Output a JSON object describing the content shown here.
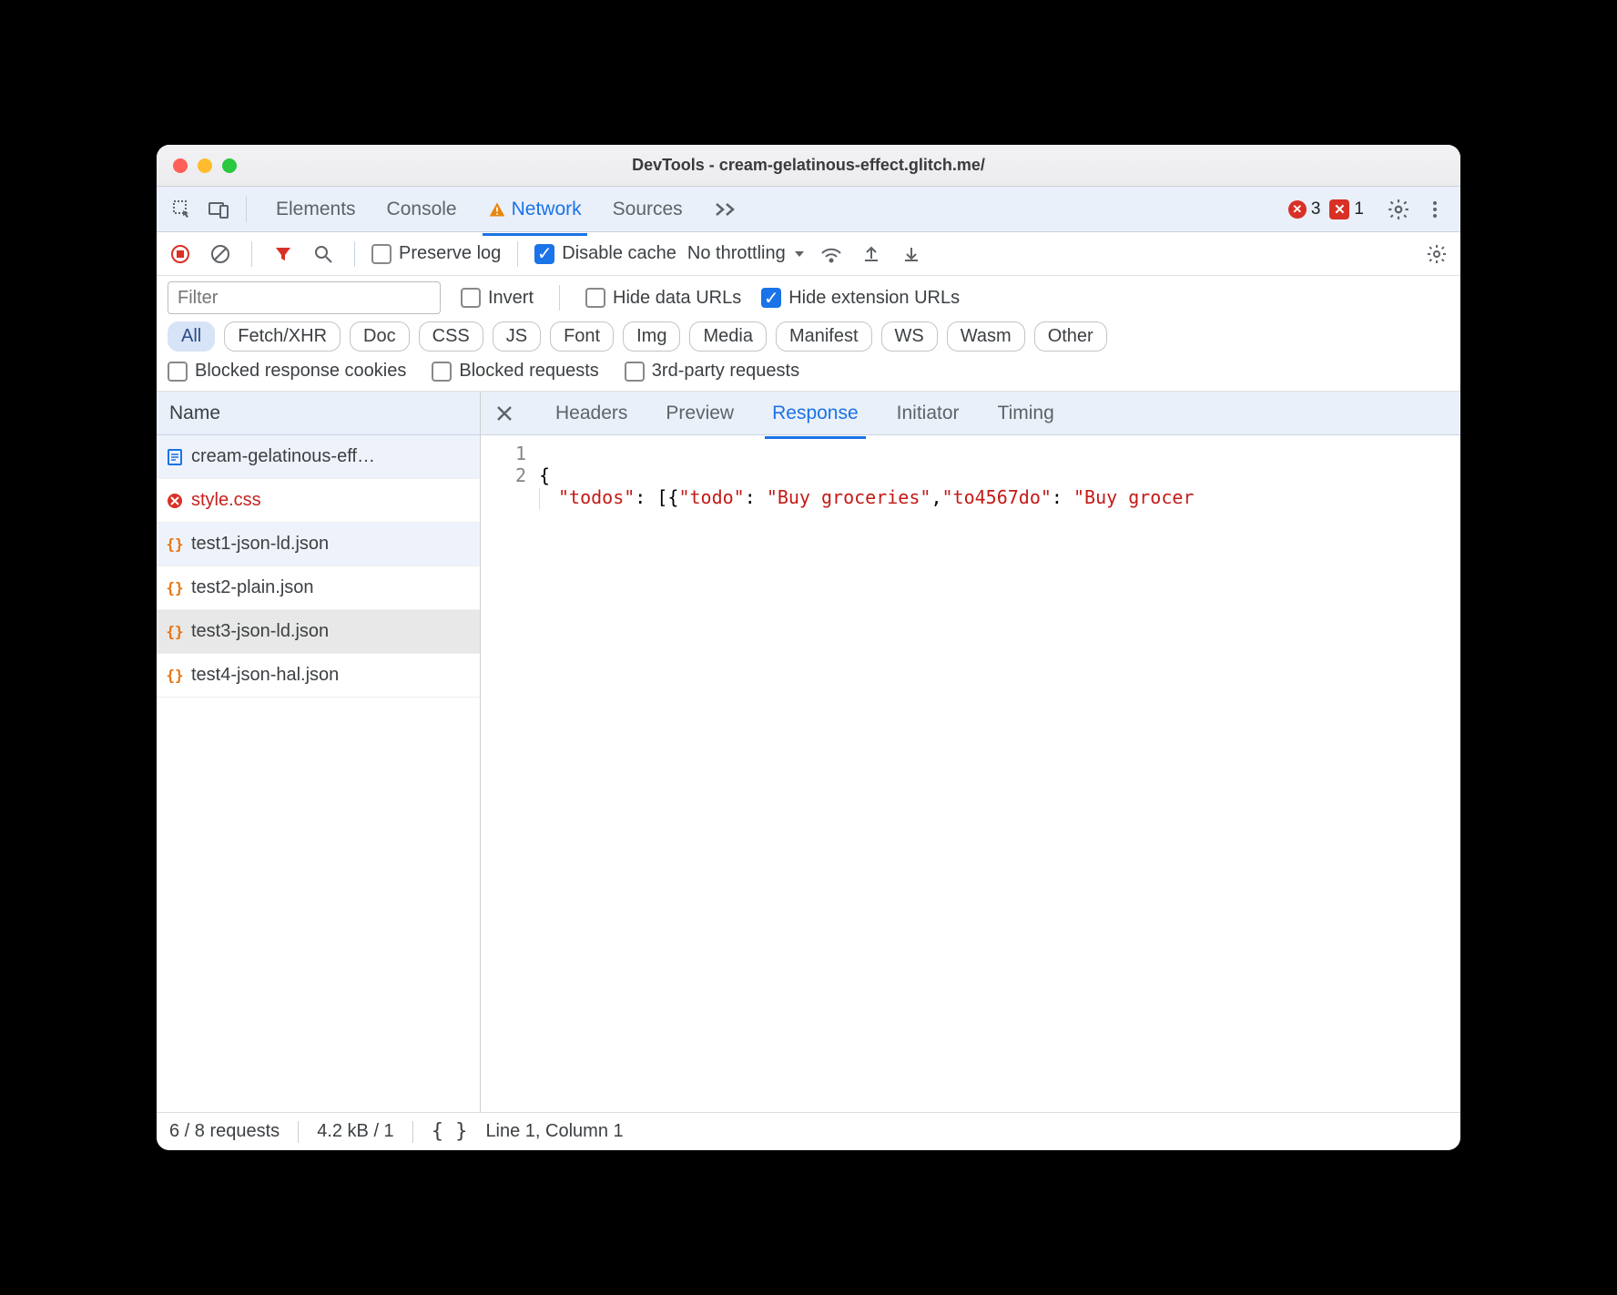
{
  "window_title": "DevTools - cream-gelatinous-effect.glitch.me/",
  "tabs": {
    "elements": "Elements",
    "console": "Console",
    "network": "Network",
    "sources": "Sources"
  },
  "counts": {
    "errors": "3",
    "issues": "1"
  },
  "toolbar": {
    "preserve_log": "Preserve log",
    "disable_cache": "Disable cache",
    "throttling": "No throttling"
  },
  "filter": {
    "placeholder": "Filter",
    "invert": "Invert",
    "hide_data": "Hide data URLs",
    "hide_ext": "Hide extension URLs"
  },
  "chips": [
    "All",
    "Fetch/XHR",
    "Doc",
    "CSS",
    "JS",
    "Font",
    "Img",
    "Media",
    "Manifest",
    "WS",
    "Wasm",
    "Other"
  ],
  "extra_filters": {
    "blocked_cookies": "Blocked response cookies",
    "blocked_requests": "Blocked requests",
    "third_party": "3rd-party requests"
  },
  "sidebar_header": "Name",
  "requests": [
    {
      "name": "cream-gelatinous-eff…",
      "icon": "doc",
      "err": false
    },
    {
      "name": "style.css",
      "icon": "err",
      "err": true
    },
    {
      "name": "test1-json-ld.json",
      "icon": "json",
      "err": false
    },
    {
      "name": "test2-plain.json",
      "icon": "json",
      "err": false
    },
    {
      "name": "test3-json-ld.json",
      "icon": "json",
      "err": false
    },
    {
      "name": "test4-json-hal.json",
      "icon": "json",
      "err": false
    }
  ],
  "selected_index": 4,
  "detail_tabs": [
    "Headers",
    "Preview",
    "Response",
    "Initiator",
    "Timing"
  ],
  "detail_active": 2,
  "response": {
    "lines": [
      "1",
      "2"
    ],
    "line1": "{",
    "line2_plain_1": "  ",
    "line2_key1": "\"todos\"",
    "line2_p1": ": [{",
    "line2_key2": "\"todo\"",
    "line2_p2": ": ",
    "line2_val1": "\"Buy groceries\"",
    "line2_p3": ",",
    "line2_key3": "\"to4567do\"",
    "line2_p4": ": ",
    "line2_val2": "\"Buy grocer"
  },
  "status": {
    "requests": "6 / 8 requests",
    "size": "4.2 kB / 1",
    "cursor": "Line 1, Column 1"
  }
}
